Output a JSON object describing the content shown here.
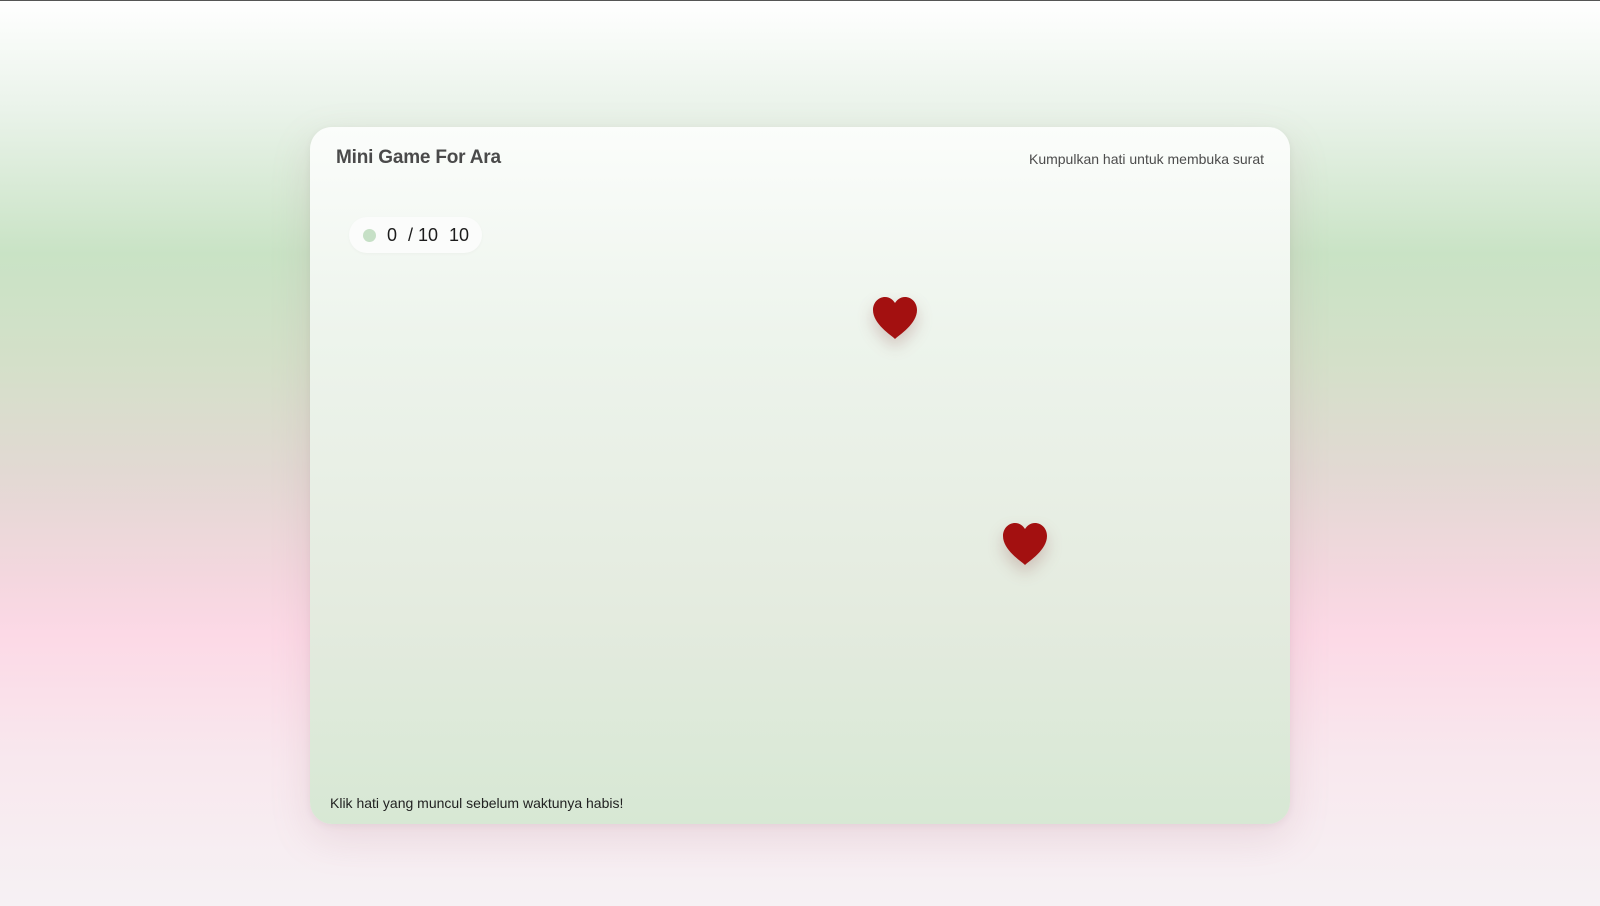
{
  "game": {
    "title": "Mini Game For Ara",
    "subtitle": "Kumpulkan hati untuk membuka surat",
    "score": {
      "collected": "0",
      "target": "/ 10",
      "time_left": "10"
    },
    "hearts": [
      {
        "icon": "heart-icon",
        "color": "#a31010"
      },
      {
        "icon": "heart-icon",
        "color": "#a31010"
      }
    ],
    "instruction": "Klik hati yang muncul sebelum waktunya habis!"
  },
  "colors": {
    "heart": "#a31010",
    "status_dot": "#c6e0c6",
    "pink_background": "#fcd9e6",
    "green_background": "#c9e3c5"
  }
}
